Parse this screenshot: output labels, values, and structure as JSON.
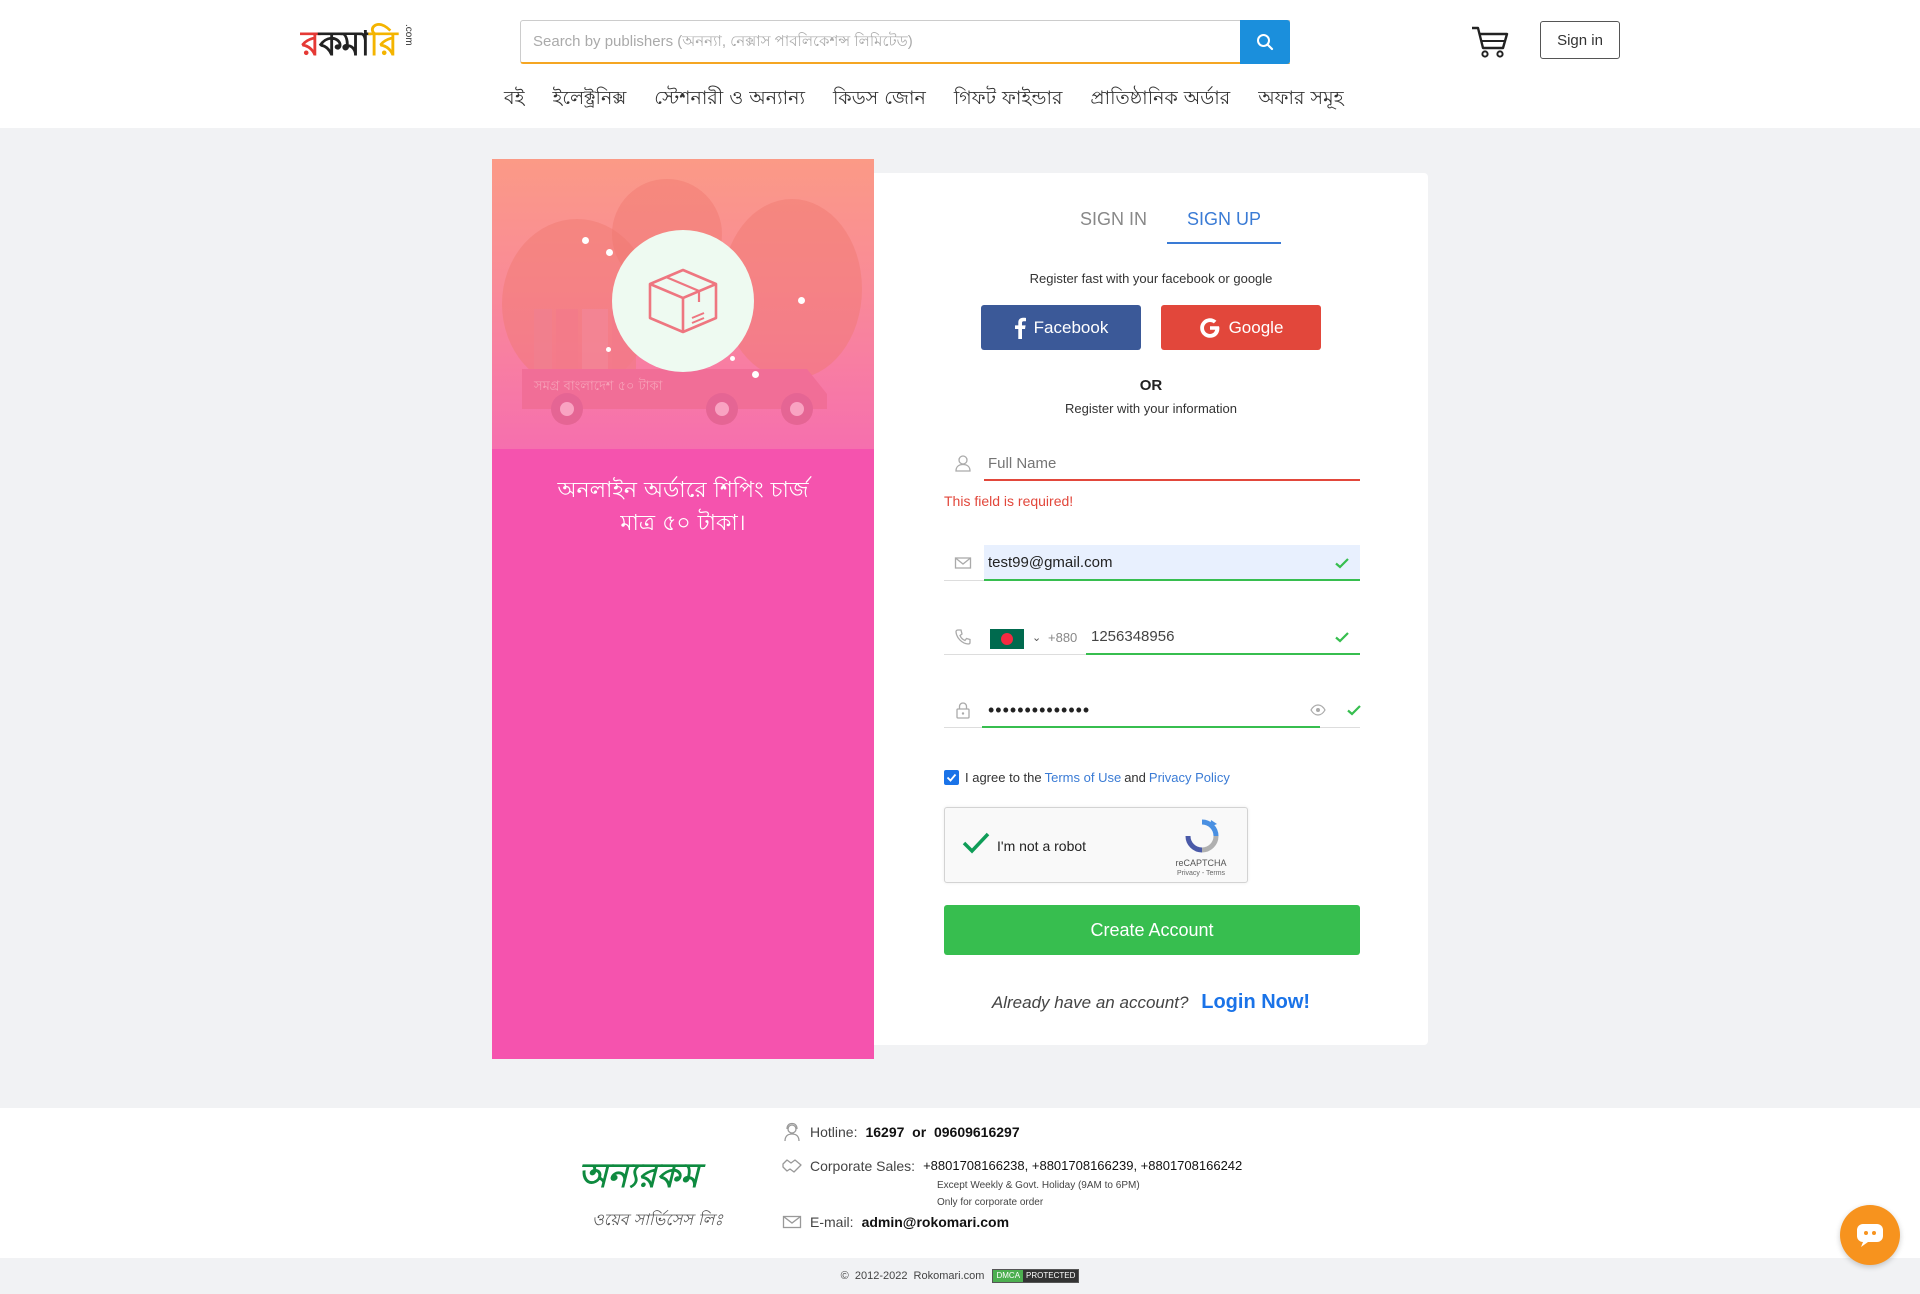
{
  "header": {
    "logo_letters": [
      "র",
      "ক",
      "মা",
      "রি"
    ],
    "logo_suffix": ".com",
    "search_placeholder": "Search by publishers (অনন্যা, নেক্সাস পাবলিকেশন্স লিমিটেড)",
    "signin_label": "Sign in",
    "nav": [
      "বই",
      "ইলেক্ট্রনিক্স",
      "স্টেশনারী ও অন্যান্য",
      "কিডস জোন",
      "গিফট ফাইন্ডার",
      "প্রাতিষ্ঠানিক অর্ডার",
      "অফার সমূহ"
    ]
  },
  "promo": {
    "line1": "অনলাইন অর্ডারে শিপিং চার্জ",
    "line2": "মাত্র ৫০ টাকা।",
    "truck_text": "সমগ্র বাংলাদেশ ৫০ টাকা"
  },
  "auth": {
    "tabs": [
      "SIGN IN",
      "SIGN UP"
    ],
    "active_tab": "SIGN UP",
    "register_fast": "Register fast with your facebook or google",
    "facebook_label": "Facebook",
    "google_label": "Google",
    "or": "OR",
    "register_info": "Register with your information",
    "fullname_placeholder": "Full Name",
    "fullname_value": "",
    "fullname_error": "This field is required!",
    "email_value": "test99@gmail.com",
    "dial_code": "+880",
    "phone_value": "1256348956",
    "password_masked": "••••••••••••••",
    "terms_prefix": "I agree to the",
    "terms_link": "Terms of Use",
    "terms_and": "and",
    "privacy_link": "Privacy Policy",
    "captcha_label": "I'm not a robot",
    "captcha_brand": "reCAPTCHA",
    "captcha_terms": "Privacy - Terms",
    "create_label": "Create Account",
    "already_text": "Already have an account?",
    "login_label": "Login Now!"
  },
  "footer": {
    "logo_main": "অন্যরকম",
    "logo_sub": "ওয়েব সার্ভিসেস লিঃ",
    "hotline_label": "Hotline:",
    "hotline_value": "16297  or  09609616297",
    "corporate_label": "Corporate Sales:",
    "corporate_value": "+8801708166238, +8801708166239, +8801708166242",
    "corporate_note1": "Except Weekly & Govt. Holiday (9AM to 6PM)",
    "corporate_note2": "Only for corporate order",
    "email_label": "E-mail:",
    "email_value": "admin@rokomari.com",
    "copyright": "©  2012-2022  Rokomari.com",
    "dmca_a": "DMCA",
    "dmca_b": "PROTECTED"
  },
  "colors": {
    "accent": "#3a7bd5",
    "promo_pink": "#f553ae",
    "success": "#37be4f",
    "error": "#e2473b",
    "facebook": "#3b5998",
    "google": "#e2473b",
    "search_btn": "#1b8fdc",
    "chat": "#f7931e"
  }
}
